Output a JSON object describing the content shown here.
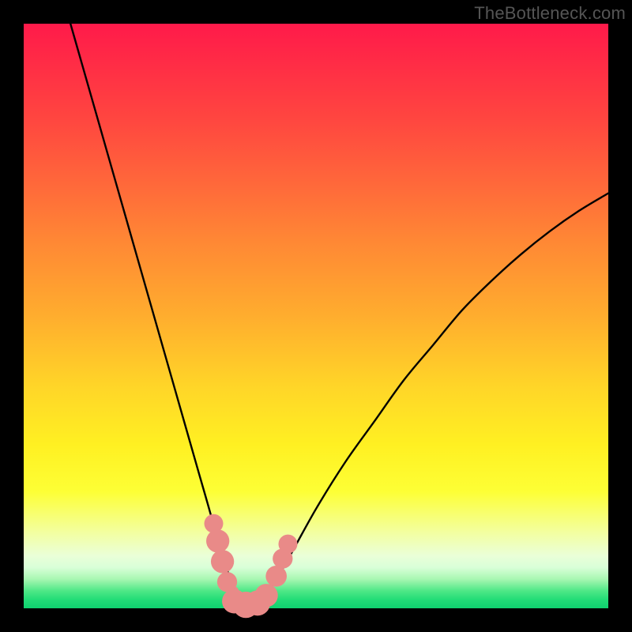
{
  "watermark": "TheBottleneck.com",
  "chart_data": {
    "type": "line",
    "title": "",
    "xlabel": "",
    "ylabel": "",
    "xlim": [
      0,
      100
    ],
    "ylim": [
      0,
      100
    ],
    "series": [
      {
        "name": "bottleneck-curve",
        "x": [
          8,
          10,
          12,
          14,
          16,
          18,
          20,
          22,
          24,
          26,
          28,
          30,
          32,
          33,
          34,
          35,
          36,
          37,
          38,
          39,
          40,
          42,
          45,
          50,
          55,
          60,
          65,
          70,
          75,
          80,
          85,
          90,
          95,
          100
        ],
        "values": [
          100,
          93,
          86,
          79,
          72,
          65,
          58,
          51,
          44,
          37,
          30,
          23,
          16,
          12,
          9,
          6,
          3,
          1,
          0,
          0,
          0.5,
          3,
          8,
          17,
          25,
          32,
          39,
          45,
          51,
          56,
          60.5,
          64.5,
          68,
          71
        ]
      }
    ],
    "markers": {
      "name": "highlight-dots",
      "color": "#e98a88",
      "points": [
        {
          "x": 32.5,
          "y": 14.5,
          "r": 1.2
        },
        {
          "x": 33.2,
          "y": 11.5,
          "r": 1.6
        },
        {
          "x": 34.0,
          "y": 8.0,
          "r": 1.6
        },
        {
          "x": 34.8,
          "y": 4.5,
          "r": 1.3
        },
        {
          "x": 36.0,
          "y": 1.2,
          "r": 1.7
        },
        {
          "x": 38.0,
          "y": 0.6,
          "r": 1.9
        },
        {
          "x": 40.0,
          "y": 0.9,
          "r": 1.8
        },
        {
          "x": 41.5,
          "y": 2.2,
          "r": 1.6
        },
        {
          "x": 43.2,
          "y": 5.5,
          "r": 1.4
        },
        {
          "x": 44.3,
          "y": 8.5,
          "r": 1.3
        },
        {
          "x": 45.2,
          "y": 11.0,
          "r": 1.2
        }
      ]
    }
  }
}
